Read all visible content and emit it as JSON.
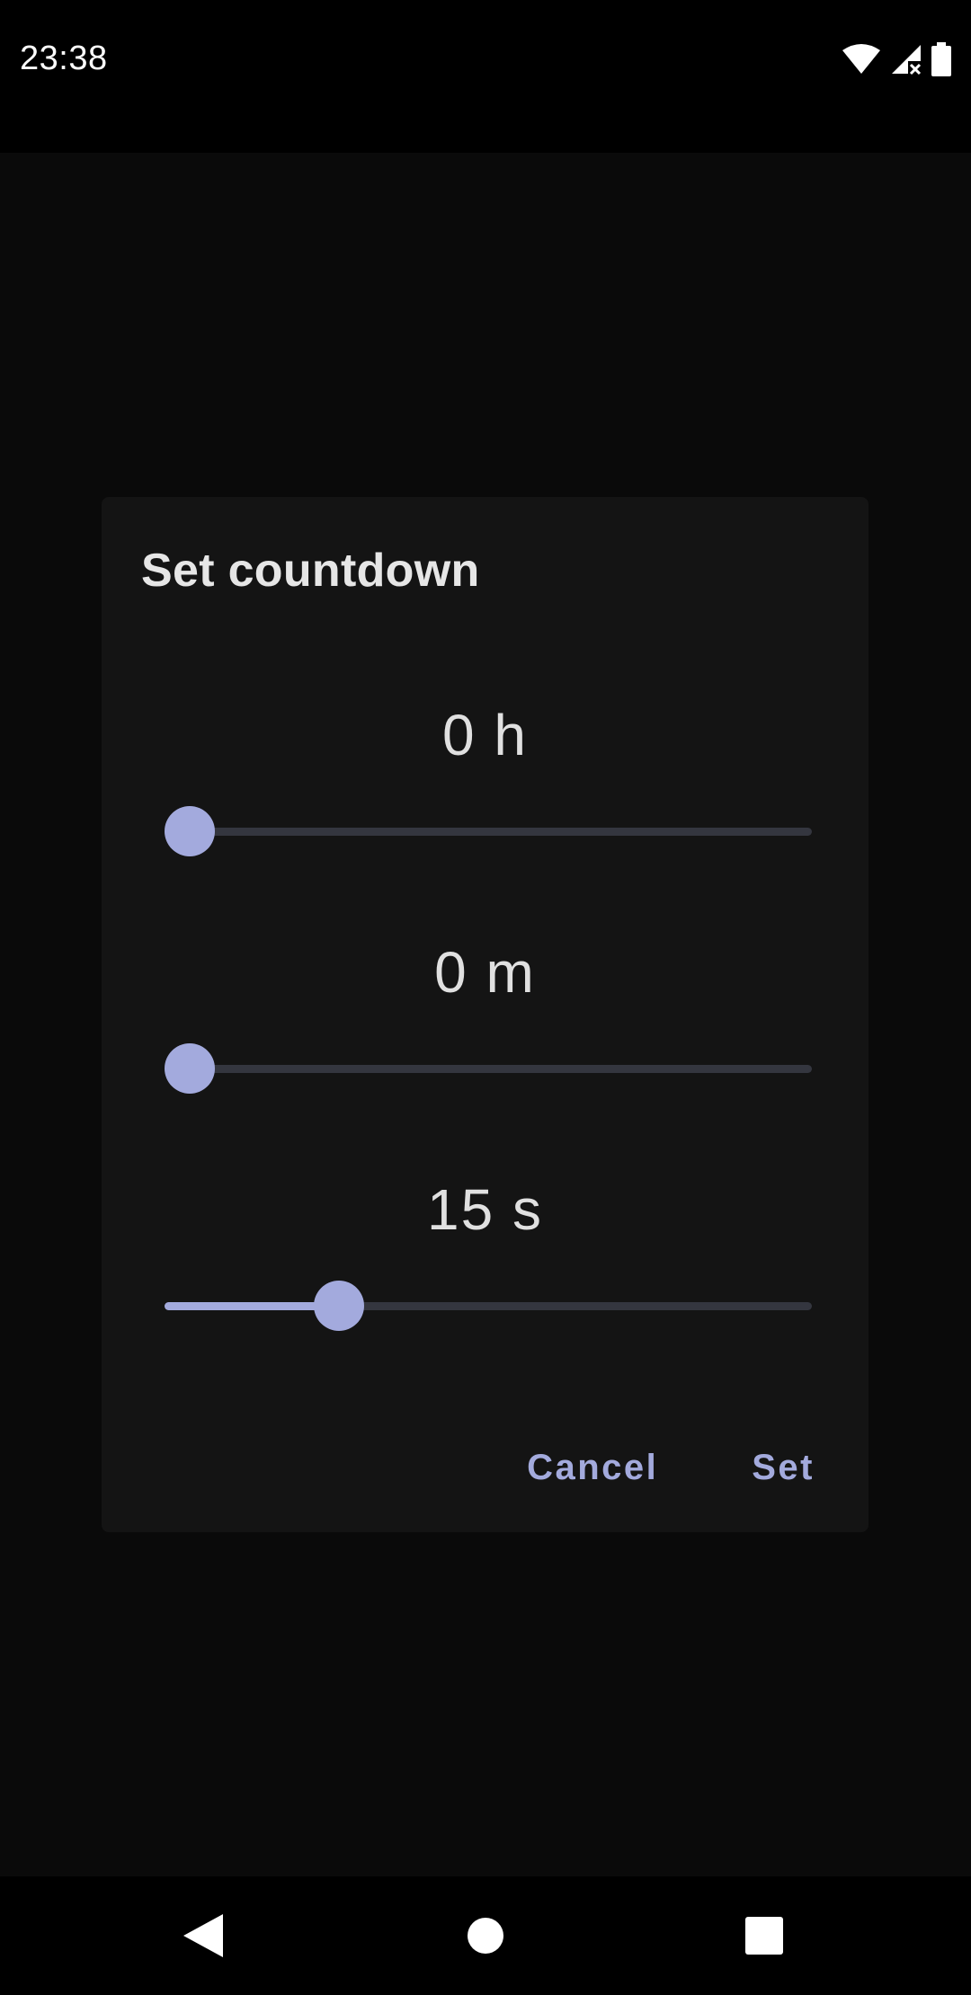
{
  "status_bar": {
    "time": "23:38",
    "icons": [
      "wifi-icon",
      "cell-signal-icon",
      "battery-icon"
    ]
  },
  "dialog": {
    "title": "Set countdown",
    "hours": {
      "label": "0 h",
      "value": 0,
      "fraction": 0.0
    },
    "minutes": {
      "label": "0 m",
      "value": 0,
      "fraction": 0.0
    },
    "seconds": {
      "label": "15 s",
      "value": 15,
      "fraction": 0.25
    },
    "cancel_label": "Cancel",
    "set_label": "Set"
  },
  "nav_bar": {
    "icons": [
      "back-icon",
      "home-icon",
      "recents-icon"
    ]
  },
  "colors": {
    "accent": "#a3aadd",
    "dialog_bg": "#141414",
    "track": "#34363f"
  }
}
